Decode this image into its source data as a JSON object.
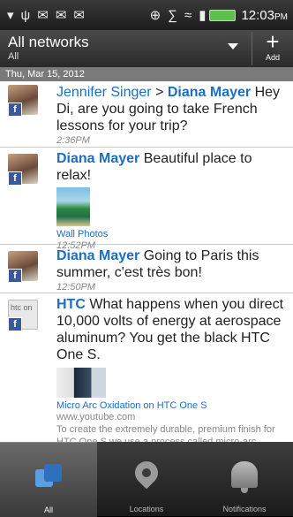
{
  "status_bar": {
    "time": "12:03",
    "ampm": "PM",
    "icons": [
      "signal-icon",
      "usb-icon",
      "mail-icon",
      "mail-icon",
      "gmail-icon",
      "gps-icon",
      "bluetooth-icon",
      "wifi-icon",
      "cell-signal-icon",
      "battery-icon"
    ]
  },
  "header": {
    "title": "All networks",
    "subtitle": "All",
    "add_label": "Add"
  },
  "date_bar": "Thu, Mar 15, 2012",
  "feed": [
    {
      "author": "Jennifer Singer",
      "arrow": " > ",
      "recipient": "Diana Mayer",
      "text": " Hey Di, are you going to take French lessons for your trip?",
      "time": "2:36PM"
    },
    {
      "author": "Diana Mayer",
      "text": " Beautiful place to relax!",
      "link": "Wall Photos",
      "time": "12:52PM"
    },
    {
      "author": "Diana Mayer",
      "text": " Going to Paris this summer, c'est très bon!",
      "time": "12:50PM"
    },
    {
      "author": "HTC",
      "avatar_text": "htc on",
      "text": " What happens when you direct 10,000 volts of energy at aerospace aluminum? You get the black HTC One S.",
      "link": "Micro Arc Oxidation on HTC One S",
      "domain": "www.youtube.com",
      "description": "To create the extremely durable, premium finish for HTC One S we use a process called micro-arc oxidation. Originally designed for use on satellites and race"
    }
  ],
  "nav": [
    {
      "label": "All",
      "icon": "all-networks-icon"
    },
    {
      "label": "Locations",
      "icon": "location-pin-icon"
    },
    {
      "label": "Notifications",
      "icon": "bell-icon"
    }
  ],
  "colors": {
    "accent": "#1a6fc4",
    "facebook": "#3b5998",
    "battery": "#5ec14c"
  }
}
